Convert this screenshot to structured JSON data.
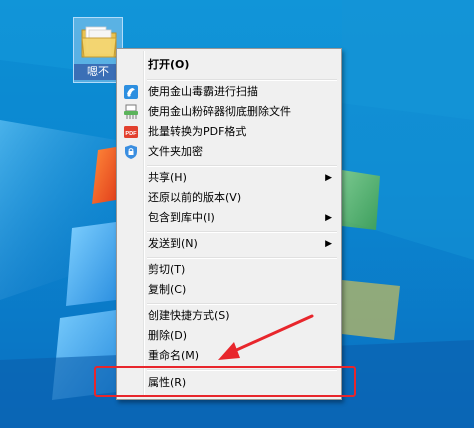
{
  "desktop": {
    "icon_caption": "嗯不"
  },
  "context_menu": {
    "open": "打开(O)",
    "scan_virus": "使用金山毒霸进行扫描",
    "shred": "使用金山粉碎器彻底删除文件",
    "to_pdf": "批量转换为PDF格式",
    "encrypt": "文件夹加密",
    "share": "共享(H)",
    "restore": "还原以前的版本(V)",
    "include_library": "包含到库中(I)",
    "send_to": "发送到(N)",
    "cut": "剪切(T)",
    "copy": "复制(C)",
    "create_shortcut": "创建快捷方式(S)",
    "delete": "删除(D)",
    "rename": "重命名(M)",
    "properties": "属性(R)",
    "pdf_badge": "PDF"
  },
  "colors": {
    "annotation": "#e8262c",
    "desktop_blue": "#0d8fd4",
    "menu_bg": "#f0f0f0"
  }
}
